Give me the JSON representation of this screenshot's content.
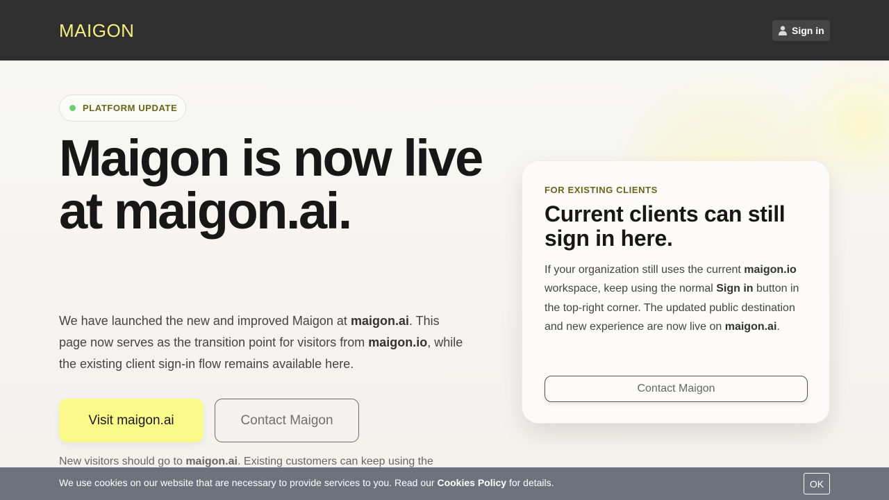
{
  "header": {
    "logo": "MAIGON",
    "signin_label": "Sign in",
    "signin_icon": "user-icon"
  },
  "hero": {
    "badge": "PLATFORM UPDATE",
    "headline": "Maigon is now live at maigon.ai.",
    "lead": {
      "p1": "We have launched the new and improved Maigon at ",
      "b1": "maigon.ai",
      "p2": ". This page now serves as the transition point for visitors from ",
      "b2": "maigon.io",
      "p3": ", while the existing client sign-in flow remains available here."
    },
    "visit_label": "Visit maigon.ai",
    "contact_label": "Contact Maigon",
    "footnote": {
      "p1": "New visitors should go to ",
      "b1": "maigon.ai",
      "p2": ". Existing customers can keep using the"
    }
  },
  "card": {
    "eyebrow": "FOR EXISTING CLIENTS",
    "title": "Current clients can still sign in here.",
    "body": {
      "p1": "If your organization still uses the current ",
      "b1": "maigon.io",
      "p2": " workspace, keep using the normal ",
      "b2": "Sign in",
      "p3": " button in the top-right corner. The updated public destination and new experience are now live on ",
      "b3": "maigon.ai",
      "p4": "."
    },
    "contact_label": "Contact Maigon"
  },
  "cookie": {
    "p1": "We use cookies on our website that are necessary to provide services to you. Read our ",
    "link": "Cookies Policy",
    "p2": " for details.",
    "ok_label": "OK"
  },
  "colors": {
    "header_bg": "#2f2f2f",
    "logo": "#f7ee7e",
    "accent_button": "#fbf98a",
    "eyebrow": "#6b6418",
    "status_dot": "#6fcf70",
    "cookie_bg": "#6c737d"
  }
}
